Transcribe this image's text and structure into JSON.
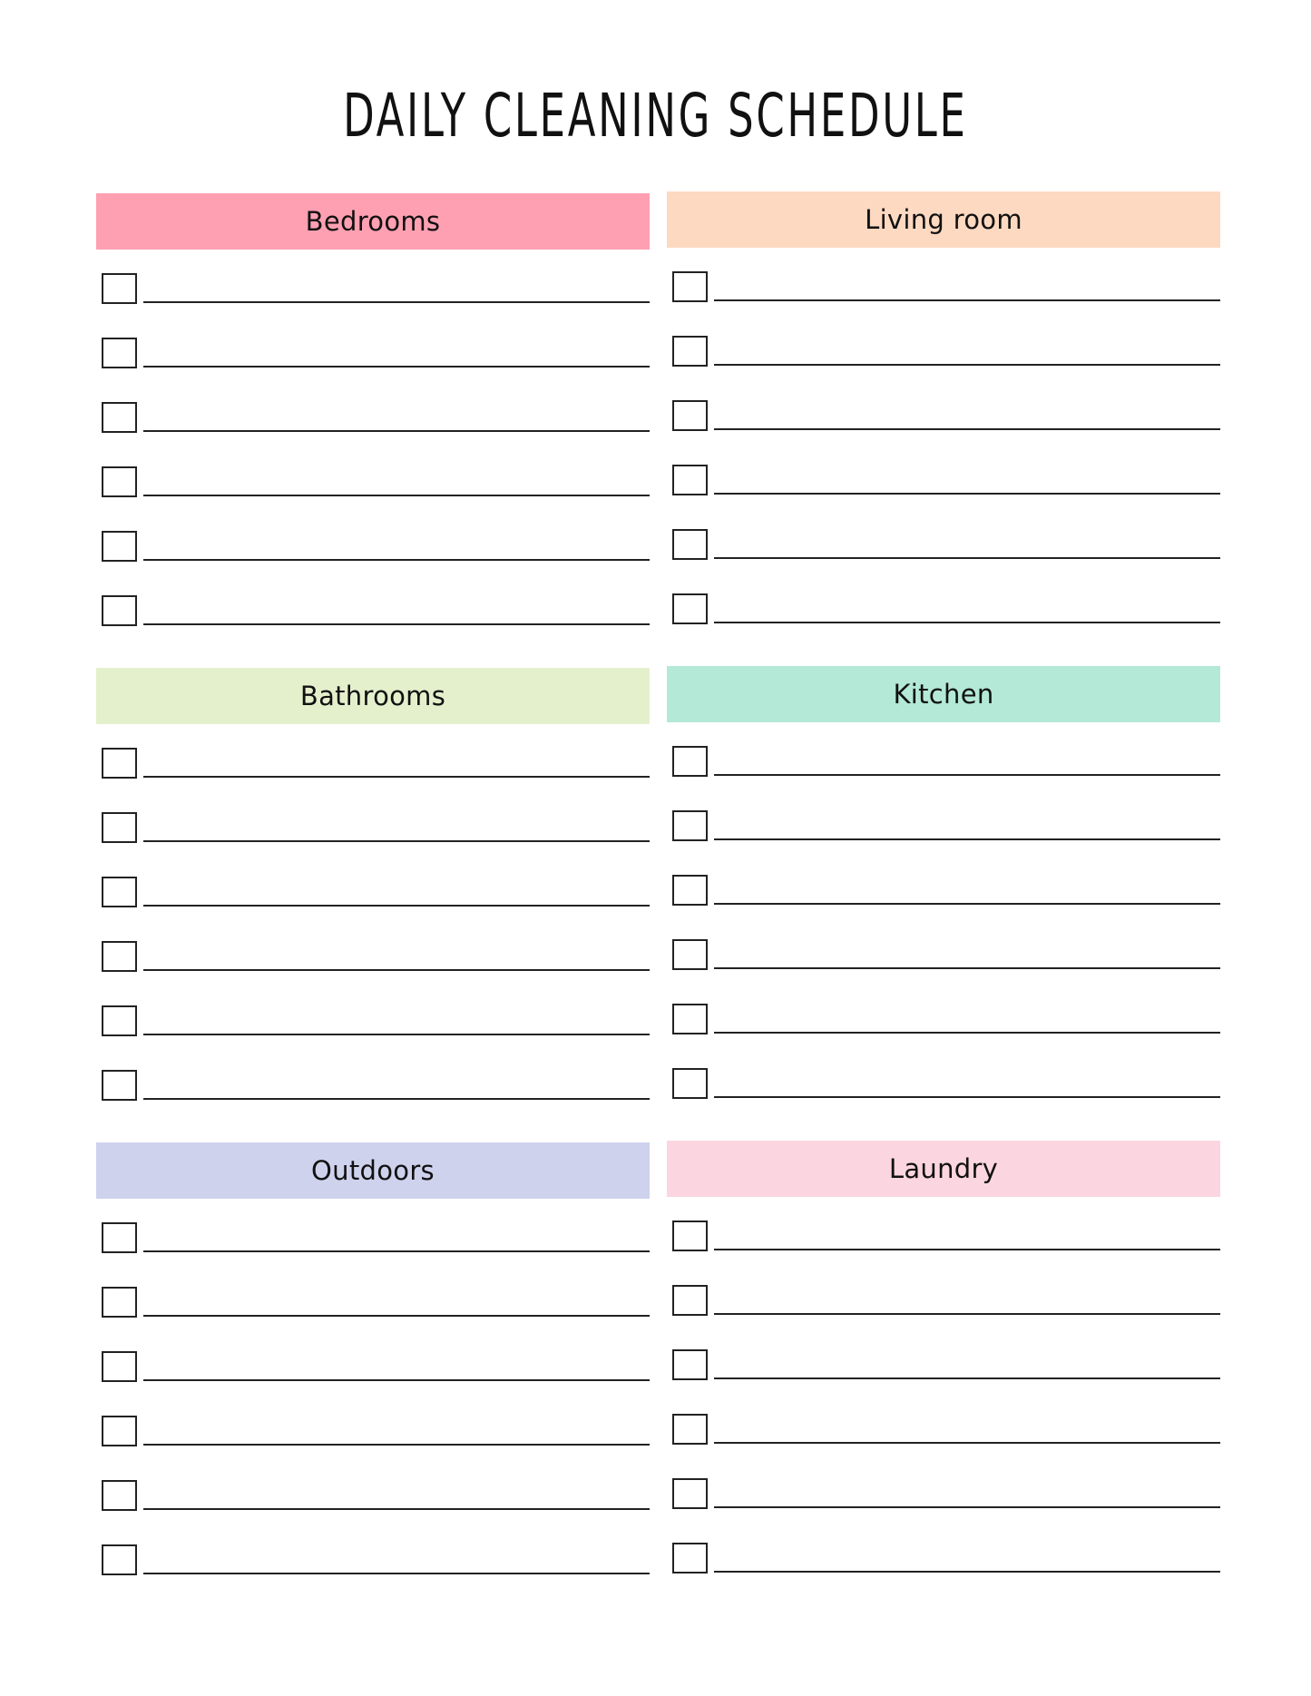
{
  "title": "DAILY CLEANING SCHEDULE",
  "sections": [
    {
      "name": "Bedrooms",
      "color": "#FFA0B2",
      "rows": 6
    },
    {
      "name": "Living room",
      "color": "#FDD9C1",
      "rows": 6
    },
    {
      "name": "Bathrooms",
      "color": "#E4F0CC",
      "rows": 6
    },
    {
      "name": "Kitchen",
      "color": "#B3E9D6",
      "rows": 6
    },
    {
      "name": "Outdoors",
      "color": "#CED2EC",
      "rows": 6
    },
    {
      "name": "Laundry",
      "color": "#FBD6E0",
      "rows": 6
    }
  ],
  "task_items": {
    "checked": [
      false,
      false,
      false,
      false,
      false,
      false
    ],
    "text": [
      "",
      "",
      "",
      "",
      "",
      ""
    ]
  }
}
